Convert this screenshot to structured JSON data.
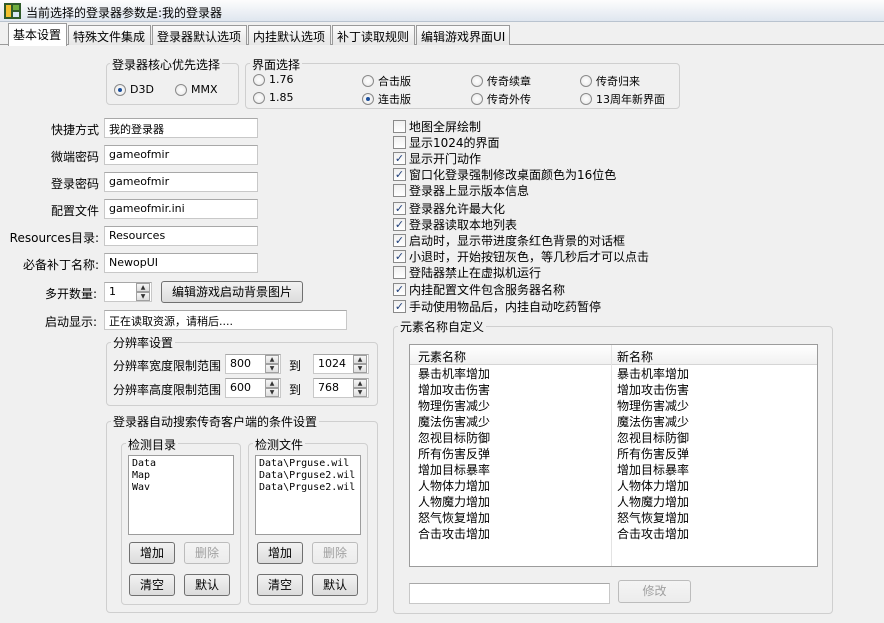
{
  "window": {
    "title": "当前选择的登录器参数是:我的登录器"
  },
  "tabs": [
    {
      "label": "基本设置",
      "active": true
    },
    {
      "label": "特殊文件集成"
    },
    {
      "label": "登录器默认选项"
    },
    {
      "label": "内挂默认选项"
    },
    {
      "label": "补丁读取规则"
    },
    {
      "label": "编辑游戏界面UI"
    }
  ],
  "core_priority": {
    "title": "登录器核心优先选择",
    "options": [
      {
        "label": "D3D",
        "selected": true
      },
      {
        "label": "MMX",
        "selected": false
      }
    ]
  },
  "ui_select": {
    "title": "界面选择",
    "options": [
      {
        "label": "1.76",
        "selected": false
      },
      {
        "label": "合击版",
        "selected": false
      },
      {
        "label": "传奇续章",
        "selected": false
      },
      {
        "label": "传奇归来",
        "selected": false
      },
      {
        "label": "1.85",
        "selected": false
      },
      {
        "label": "连击版",
        "selected": true
      },
      {
        "label": "传奇外传",
        "selected": false
      },
      {
        "label": "13周年新界面",
        "selected": false
      }
    ]
  },
  "fields": {
    "shortcut": {
      "label": "快捷方式",
      "value": "我的登录器"
    },
    "micro_password": {
      "label": "微端密码",
      "value": "gameofmir"
    },
    "login_password": {
      "label": "登录密码",
      "value": "gameofmir"
    },
    "config_file": {
      "label": "配置文件",
      "value": "gameofmir.ini"
    },
    "resources_dir": {
      "label": "Resources目录:",
      "value": "Resources"
    },
    "required_patch": {
      "label": "必备补丁名称:",
      "value": "NewopUI"
    },
    "multi_open": {
      "label": "多开数量:",
      "value": "1"
    },
    "startup_display": {
      "label": "启动显示:",
      "value": "正在读取资源，请稍后...."
    }
  },
  "edit_bg_button": "编辑游戏启动背景图片",
  "resolution": {
    "title": "分辨率设置",
    "width": {
      "label": "分辨率宽度限制范围",
      "from": "800",
      "to_label": "到",
      "to": "1024"
    },
    "height": {
      "label": "分辨率高度限制范围",
      "from": "600",
      "to_label": "到",
      "to": "768"
    }
  },
  "search": {
    "title": "登录器自动搜索传奇客户端的条件设置",
    "dirs": {
      "title": "检测目录",
      "items": [
        "Data",
        "Map",
        "Wav"
      ],
      "add": "增加",
      "del": "删除",
      "clear": "清空",
      "default": "默认"
    },
    "files": {
      "title": "检测文件",
      "items": [
        "Data\\Prguse.wil",
        "Data\\Prguse2.wil",
        "Data\\Prguse2.wil"
      ],
      "add": "增加",
      "del": "删除",
      "clear": "清空",
      "default": "默认"
    }
  },
  "options": [
    {
      "label": "地图全屏绘制",
      "checked": false
    },
    {
      "label": "显示1024的界面",
      "checked": false
    },
    {
      "label": "显示开门动作",
      "checked": true
    },
    {
      "label": "窗口化登录强制修改桌面颜色为16位色",
      "checked": true
    },
    {
      "label": "登录器上显示版本信息",
      "checked": false
    },
    {
      "label": "登录器允许最大化",
      "checked": true
    },
    {
      "label": "登录器读取本地列表",
      "checked": true
    },
    {
      "label": "启动时，显示带进度条红色背景的对话框",
      "checked": true
    },
    {
      "label": "小退时，开始按钮灰色，等几秒后才可以点击",
      "checked": true
    },
    {
      "label": "登陆器禁止在虚拟机运行",
      "checked": false
    },
    {
      "label": "内挂配置文件包含服务器名称",
      "checked": true
    },
    {
      "label": "手动使用物品后，内挂自动吃药暂停",
      "checked": true
    }
  ],
  "element_names": {
    "title": "元素名称自定义",
    "col_name": "元素名称",
    "col_new": "新名称",
    "rows": [
      [
        "暴击机率增加",
        "暴击机率增加"
      ],
      [
        "增加攻击伤害",
        "增加攻击伤害"
      ],
      [
        "物理伤害减少",
        "物理伤害减少"
      ],
      [
        "魔法伤害减少",
        "魔法伤害减少"
      ],
      [
        "忽视目标防御",
        "忽视目标防御"
      ],
      [
        "所有伤害反弹",
        "所有伤害反弹"
      ],
      [
        "增加目标暴率",
        "增加目标暴率"
      ],
      [
        "人物体力增加",
        "人物体力增加"
      ],
      [
        "人物魔力增加",
        "人物魔力增加"
      ],
      [
        "怒气恢复增加",
        "怒气恢复增加"
      ],
      [
        "合击攻击增加",
        "合击攻击增加"
      ]
    ],
    "edit_value": "",
    "modify_button": "修改"
  }
}
